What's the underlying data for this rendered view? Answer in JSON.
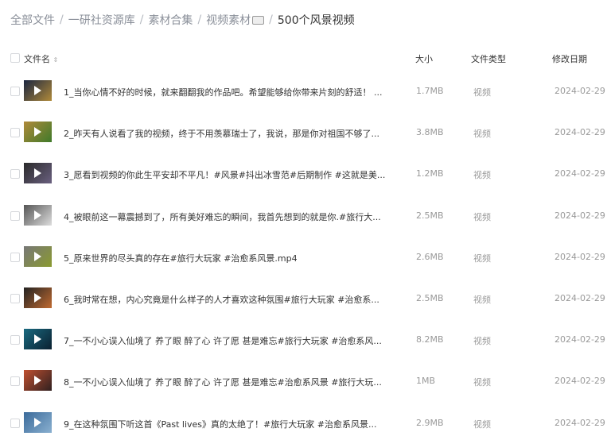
{
  "breadcrumb": [
    "全部文件",
    "一研社资源库",
    "素材合集",
    "视频素材",
    "500个风景视频"
  ],
  "columns": {
    "name": "文件名",
    "size": "大小",
    "type": "文件类型",
    "date": "修改日期"
  },
  "files": [
    {
      "name": "1_当你心情不好的时候，就来翻翻我的作品吧。希望能够给你带来片刻的舒适！ ...",
      "size": "1.7MB",
      "type": "视频",
      "date": "2024-02-29 1",
      "thumb": [
        "#1a2540",
        "#b08a3a"
      ]
    },
    {
      "name": "2_昨天有人说看了我的视频，终于不用羡慕瑞士了，我说，那是你对祖国不够了...",
      "size": "3.8MB",
      "type": "视频",
      "date": "2024-02-29 1",
      "thumb": [
        "#b08a3a",
        "#3f7a2a"
      ]
    },
    {
      "name": "3_愿看到视频的你此生平安却不平凡！#风景#抖出冰雪范#后期制作 #这就是美...",
      "size": "1.2MB",
      "type": "视频",
      "date": "2024-02-29 1",
      "thumb": [
        "#2a2a2a",
        "#6a6080"
      ]
    },
    {
      "name": "4_被眼前这一幕震撼到了，所有美好难忘的瞬间，我首先想到的就是你.#旅行大...",
      "size": "2.5MB",
      "type": "视频",
      "date": "2024-02-29 1",
      "thumb": [
        "#555",
        "#ddd"
      ]
    },
    {
      "name": "5_原来世界的尽头真的存在#旅行大玩家 #治愈系风景.mp4",
      "size": "2.6MB",
      "type": "视频",
      "date": "2024-02-29 1",
      "thumb": [
        "#777",
        "#8a9a30"
      ]
    },
    {
      "name": "6_我时常在想，内心究竟是什么样子的人才喜欢这种氛围#旅行大玩家 #治愈系...",
      "size": "2.5MB",
      "type": "视频",
      "date": "2024-02-29 1",
      "thumb": [
        "#222",
        "#c06a30"
      ]
    },
    {
      "name": "7_一不小心误入仙境了 养了眼 醉了心 许了愿 甚是难忘#旅行大玩家 #治愈系风...",
      "size": "8.2MB",
      "type": "视频",
      "date": "2024-02-29 1",
      "thumb": [
        "#1a6a80",
        "#0a2030"
      ]
    },
    {
      "name": "8_一不小心误入仙境了 养了眼 醉了心 许了愿 甚是难忘#治愈系风景 #旅行大玩...",
      "size": "1MB",
      "type": "视频",
      "date": "2024-02-29 1",
      "thumb": [
        "#c05030",
        "#302020"
      ]
    },
    {
      "name": "9_在这种氛围下听这首《Past lives》真的太绝了！#旅行大玩家 #治愈系风景...",
      "size": "2.9MB",
      "type": "视频",
      "date": "2024-02-29 1",
      "thumb": [
        "#3a6a9a",
        "#8ab0d0"
      ]
    }
  ]
}
